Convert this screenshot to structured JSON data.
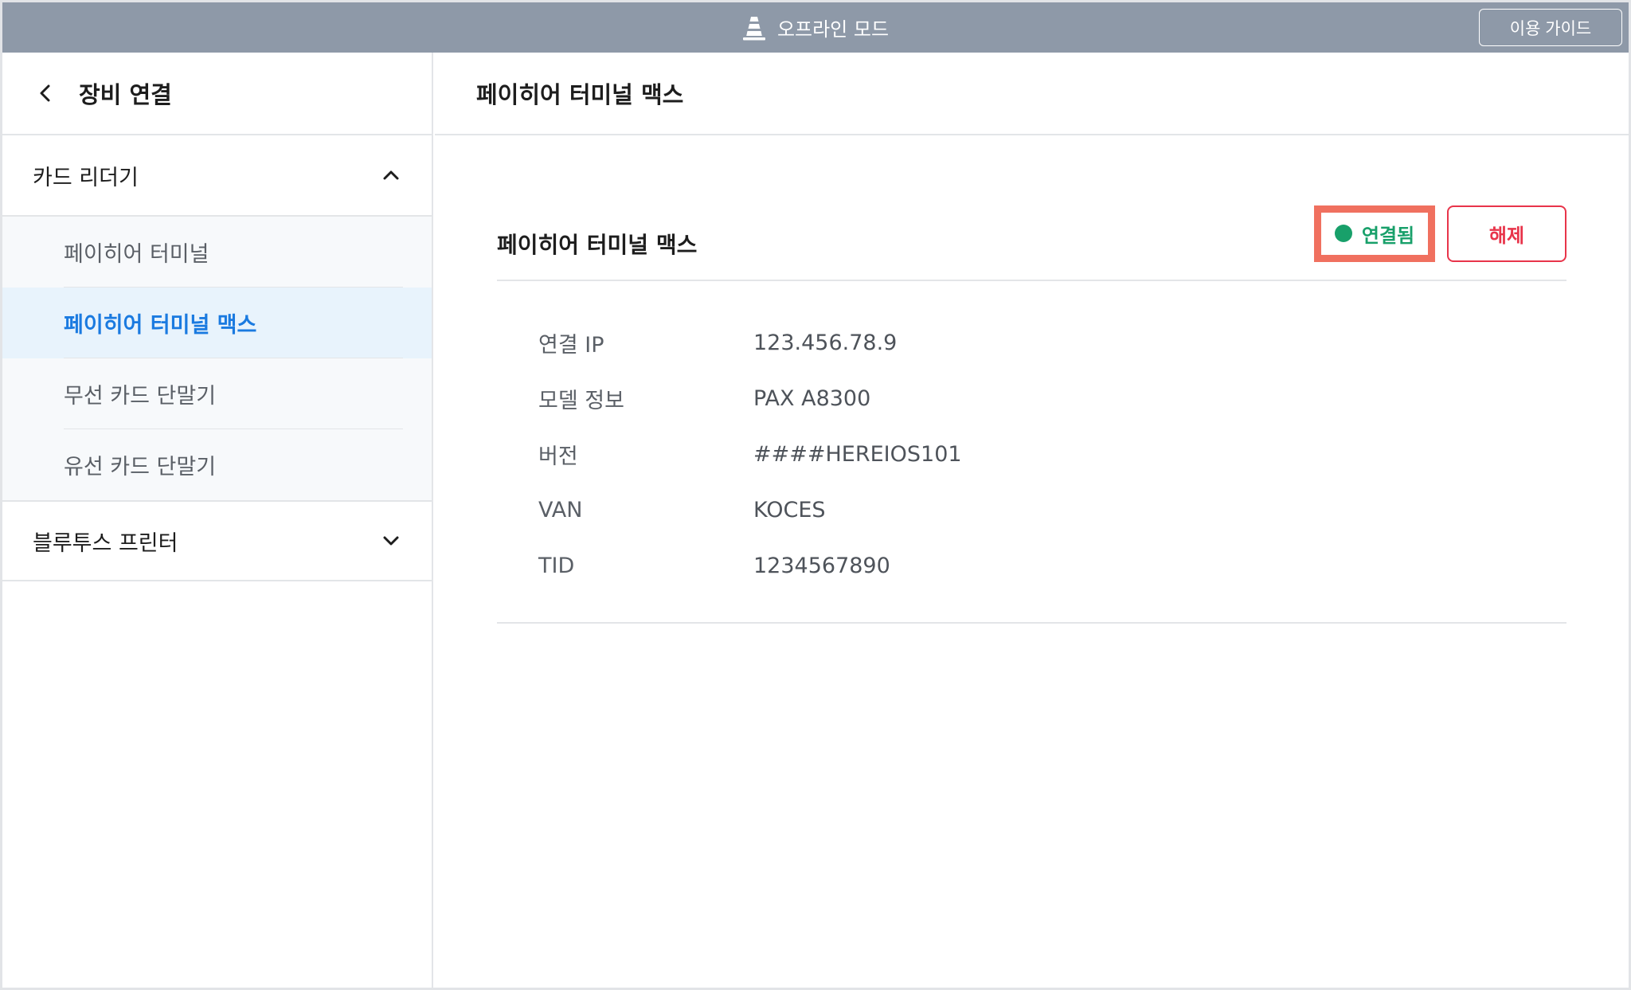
{
  "topbar": {
    "mode_label": "오프라인 모드",
    "guide_button": "이용 가이드",
    "color": "#8e99a8"
  },
  "sidebar": {
    "title": "장비 연결",
    "groups": [
      {
        "label": "카드 리더기",
        "expanded": true,
        "items": [
          {
            "label": "페이히어 터미널",
            "active": false
          },
          {
            "label": "페이히어 터미널 맥스",
            "active": true
          },
          {
            "label": "무선 카드 단말기",
            "active": false
          },
          {
            "label": "유선 카드 단말기",
            "active": false
          }
        ]
      },
      {
        "label": "블루투스 프린터",
        "expanded": false,
        "items": []
      }
    ]
  },
  "main": {
    "title": "페이히어 터미널 맥스",
    "device": {
      "name": "페이히어 터미널 맥스",
      "status": "연결됨",
      "status_color": "#18a06a",
      "disconnect_label": "해제",
      "disconnect_color": "#e8344a",
      "details": [
        {
          "key": "연결 IP",
          "value": "123.456.78.9"
        },
        {
          "key": "모델 정보",
          "value": "PAX A8300"
        },
        {
          "key": "버전",
          "value": "####HEREIOS101"
        },
        {
          "key": "VAN",
          "value": "KOCES"
        },
        {
          "key": "TID",
          "value": "1234567890"
        }
      ]
    }
  }
}
